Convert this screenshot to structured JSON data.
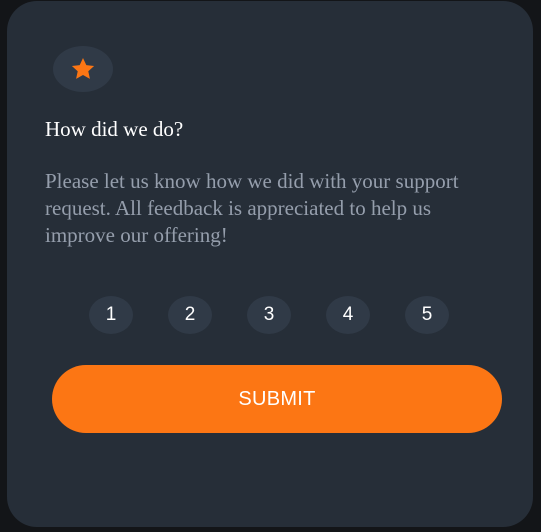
{
  "card": {
    "icon": "star-icon",
    "title": "How did we do?",
    "description": "Please let us know how we did with your support request. All feedback is appreciated to help us improve our offering!",
    "ratings": [
      "1",
      "2",
      "3",
      "4",
      "5"
    ],
    "submit_label": "SUBMIT"
  },
  "colors": {
    "background": "#262e38",
    "accent": "#fc7614",
    "rating_bg": "#303a47",
    "muted_text": "#959eac",
    "text": "#ffffff"
  }
}
